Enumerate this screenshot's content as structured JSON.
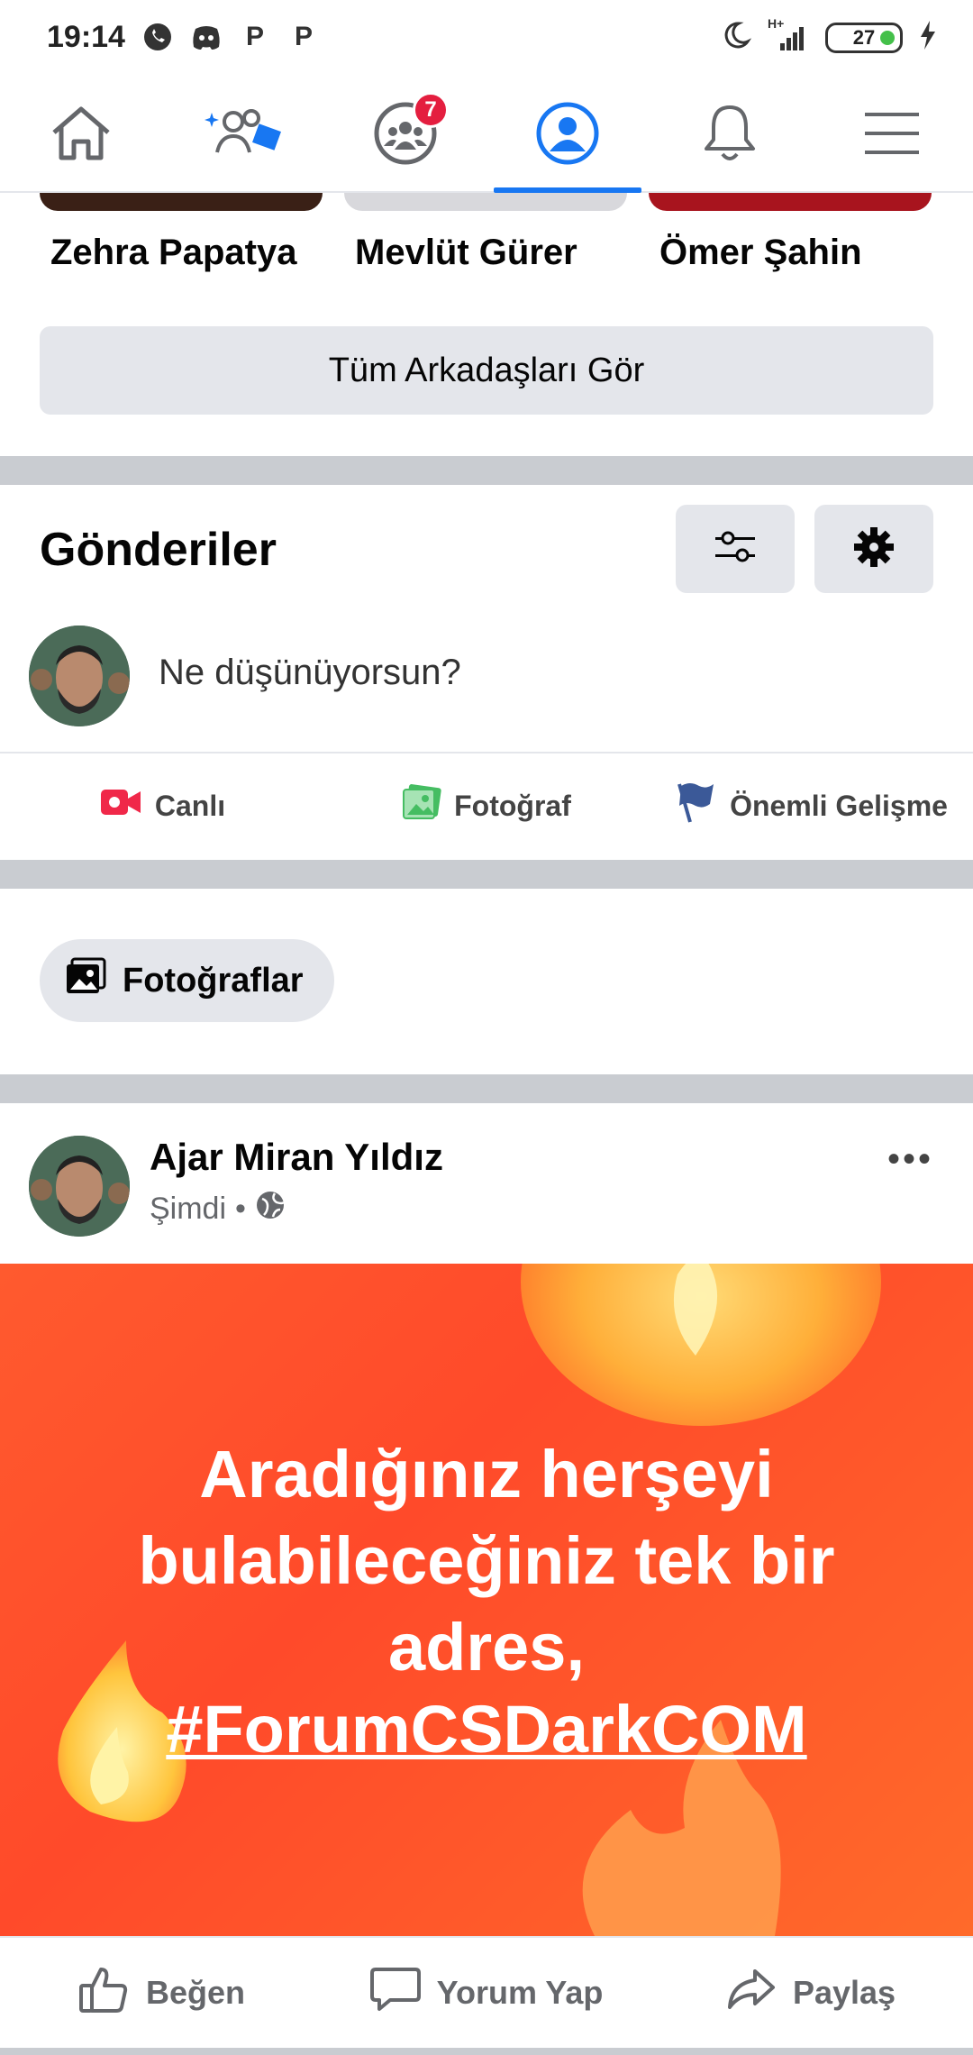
{
  "status_bar": {
    "time": "19:14",
    "network": "H+",
    "battery": "27"
  },
  "navbar": {
    "items": [
      {
        "name": "home",
        "icon": "home-icon"
      },
      {
        "name": "friends",
        "icon": "friends-icon"
      },
      {
        "name": "groups",
        "icon": "groups-icon",
        "badge": "7"
      },
      {
        "name": "profile",
        "icon": "profile-icon",
        "active": true
      },
      {
        "name": "notifications",
        "icon": "bell-icon"
      },
      {
        "name": "menu",
        "icon": "menu-icon"
      }
    ],
    "accent_color": "#1877f2"
  },
  "friends": {
    "names": [
      "Zehra Papatya",
      "Mevlüt Gürer",
      "Ömer Şahin"
    ],
    "see_all_label": "Tüm Arkadaşları Gör"
  },
  "posts_section": {
    "title": "Gönderiler",
    "composer_prompt": "Ne düşünüyorsun?",
    "actions": [
      "Canlı",
      "Fotoğraf",
      "Önemli Gelişme"
    ]
  },
  "photos_chip": {
    "label": "Fotoğraflar"
  },
  "post": {
    "author": "Ajar Miran Yıldız",
    "time": "Şimdi",
    "separator": "•",
    "text": "Aradığınız herşeyi\nbulabileceğiniz tek bir\nadres,",
    "hashtag": "#ForumCSDarkCOM",
    "actions": [
      "Beğen",
      "Yorum Yap",
      "Paylaş"
    ]
  }
}
